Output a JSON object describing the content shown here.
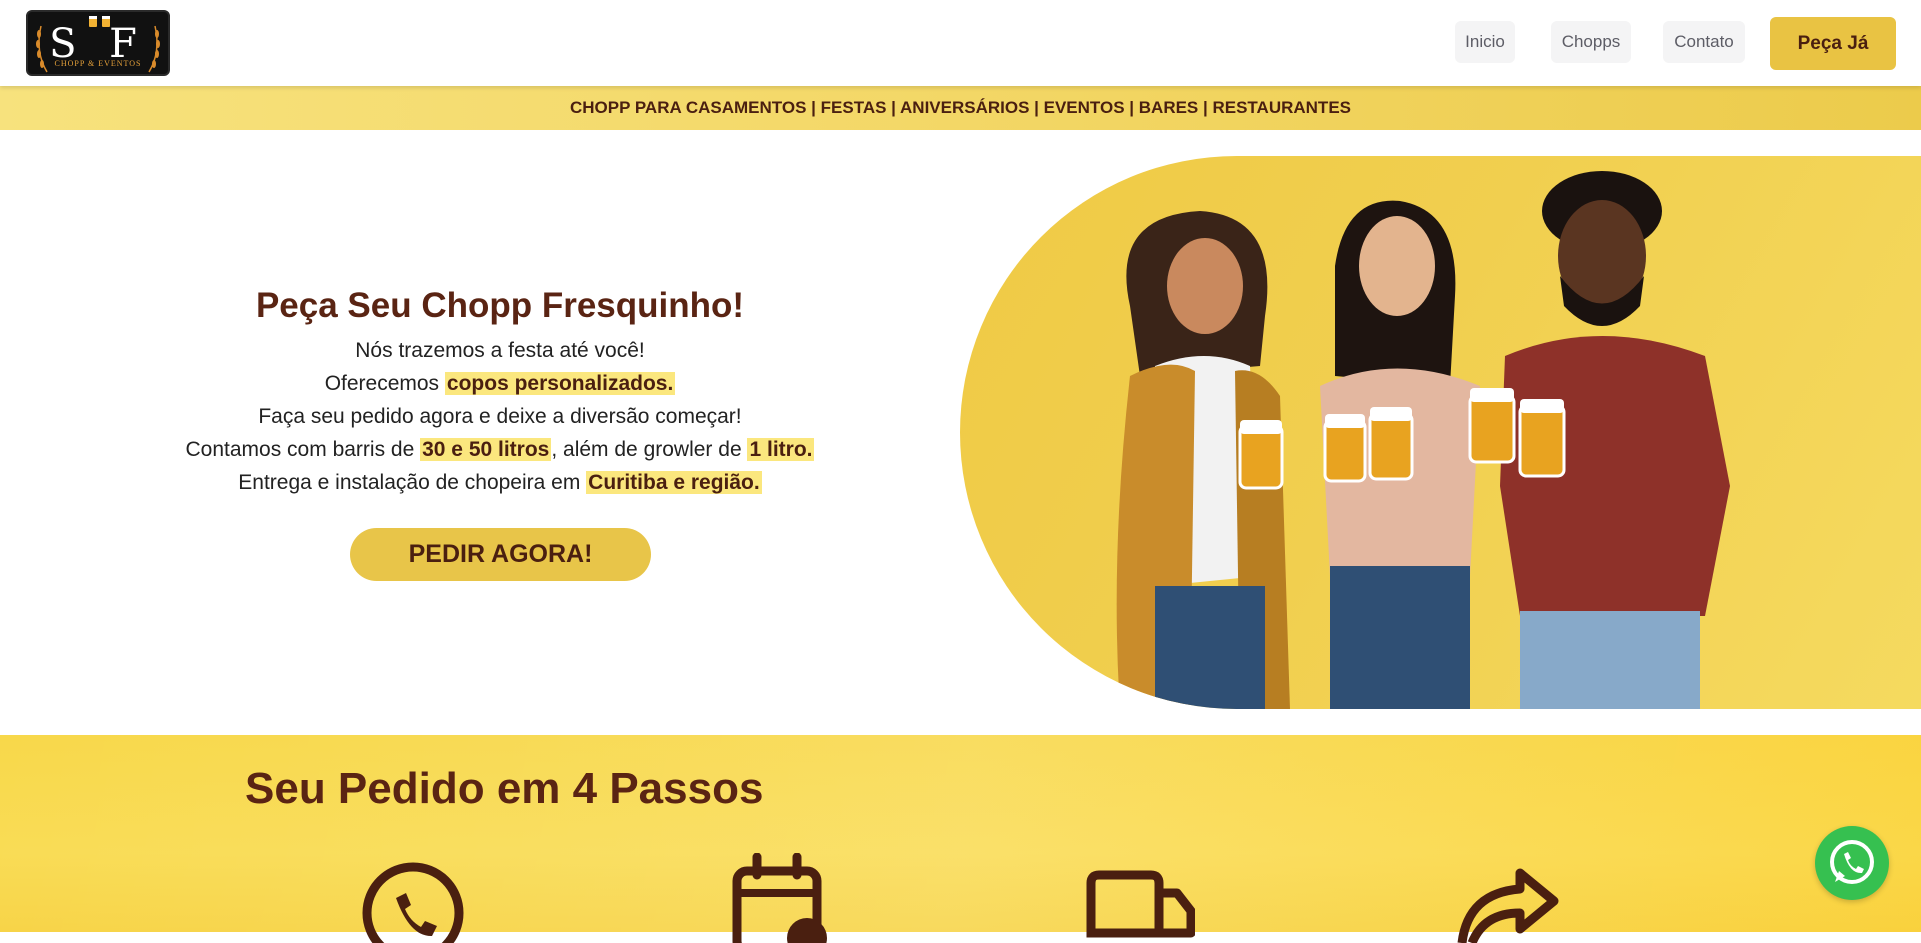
{
  "header": {
    "logo": {
      "monogram": "S F",
      "tagline": "CHOPP & EVENTOS"
    },
    "nav": [
      {
        "label": "Inicio"
      },
      {
        "label": "Chopps"
      },
      {
        "label": "Contato"
      }
    ],
    "cta_label": "Peça Já"
  },
  "banner": {
    "text": "CHOPP PARA CASAMENTOS | FESTAS | ANIVERSÁRIOS | EVENTOS | BARES | RESTAURANTES"
  },
  "hero": {
    "title": "Peça Seu Chopp Fresquinho!",
    "line1": "Nós trazemos a festa até você!",
    "line2_pre": "Oferecemos ",
    "line2_hl": "copos personalizados.",
    "line3": "Faça seu pedido agora e deixe a diversão começar!",
    "line4_pre": "Contamos com barris de ",
    "line4_hl1": "30 e 50 litros",
    "line4_mid": ", além de growler de ",
    "line4_hl2": "1 litro.",
    "line5_pre": "Entrega e instalação de chopeira em ",
    "line5_hl": "Curitiba e região.",
    "button_label": "PEDIR AGORA!"
  },
  "steps": {
    "title": "Seu Pedido em 4 Passos",
    "icons": [
      "phone-icon",
      "calendar-check-icon",
      "truck-icon",
      "share-arrow-icon"
    ]
  },
  "colors": {
    "accent_yellow": "#e9c343",
    "brown_text": "#5a2413",
    "highlight": "#fbe77e",
    "whatsapp": "#36c050"
  }
}
